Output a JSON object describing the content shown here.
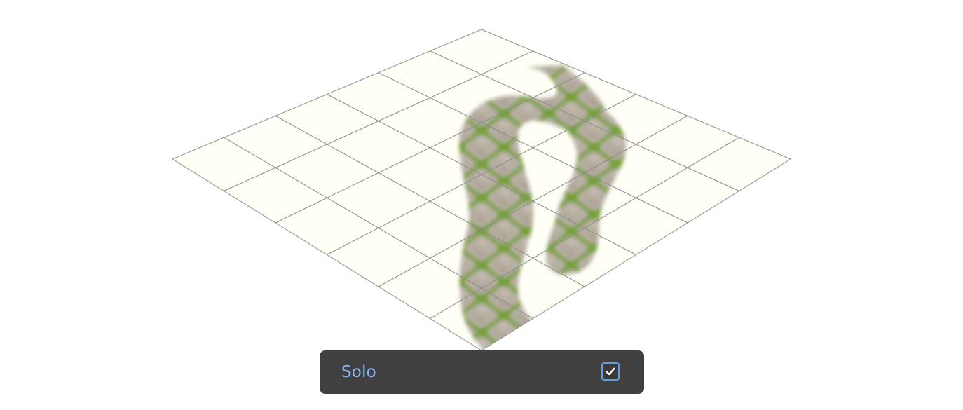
{
  "scene": {
    "grid": {
      "rows": 6,
      "cols": 6
    },
    "plane_color": "#fffff6",
    "grid_line_color": "#8a8a8a",
    "outline_color": "#a0a0a0",
    "path_material": "cobblestone-with-grass",
    "stone_color": "#b6ada1",
    "grass_color": "#77a039"
  },
  "solo": {
    "label": "Solo",
    "checked": true,
    "label_color": "#86b4f4",
    "checkbox_border_color": "#5b9ef0",
    "panel_color": "#404040",
    "check_icon": "checkmark-icon"
  }
}
